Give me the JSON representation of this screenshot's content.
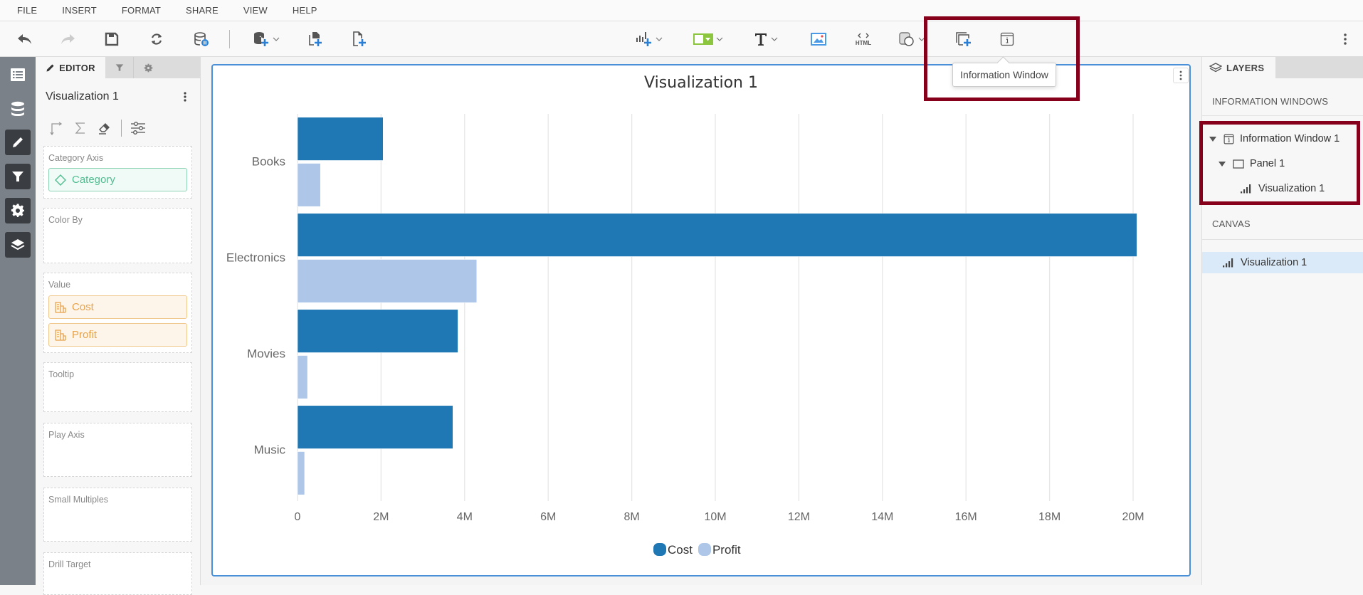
{
  "menu": [
    "FILE",
    "INSERT",
    "FORMAT",
    "SHARE",
    "VIEW",
    "HELP"
  ],
  "toolbar": {
    "tooltip": "Information Window",
    "html_label": "HTML",
    "items": [
      "undo",
      "redo",
      "save",
      "refresh",
      "pause-data",
      "add-data",
      "duplicate-page",
      "new-page",
      "insert-visualization",
      "insert-filter",
      "insert-text",
      "insert-image",
      "insert-html",
      "insert-shape",
      "insert-panel",
      "insert-information-window",
      "more"
    ]
  },
  "editor": {
    "tabs": {
      "editor": "EDITOR"
    },
    "title": "Visualization 1",
    "wells": [
      {
        "label": "Category Axis",
        "items": [
          {
            "label": "Category",
            "kind": "attribute"
          }
        ]
      },
      {
        "label": "Color By",
        "items": []
      },
      {
        "label": "Value",
        "items": [
          {
            "label": "Cost",
            "kind": "metric"
          },
          {
            "label": "Profit",
            "kind": "metric"
          }
        ]
      },
      {
        "label": "Tooltip",
        "items": []
      },
      {
        "label": "Play Axis",
        "items": []
      },
      {
        "label": "Small Multiples",
        "items": []
      },
      {
        "label": "Drill Target",
        "items": []
      }
    ]
  },
  "layers": {
    "tab": "LAYERS",
    "sections": {
      "info_windows": "INFORMATION WINDOWS",
      "canvas": "CANVAS"
    },
    "info_tree": [
      {
        "label": "Information Window 1",
        "level": 0,
        "expanded": true
      },
      {
        "label": "Panel 1",
        "level": 1,
        "expanded": true
      },
      {
        "label": "Visualization 1",
        "level": 2
      }
    ],
    "canvas_items": [
      {
        "label": "Visualization 1",
        "selected": true
      }
    ]
  },
  "colors": {
    "highlight": "#86001b",
    "cost": "#1f77b4",
    "profit": "#aec7e8",
    "accent": "#4a90d9"
  },
  "chart_data": {
    "type": "bar",
    "orientation": "horizontal",
    "title": "Visualization 1",
    "categories": [
      "Books",
      "Electronics",
      "Movies",
      "Music"
    ],
    "series": [
      {
        "name": "Cost",
        "color": "#1f77b4",
        "values": [
          2050000,
          20090000,
          3840000,
          3720000
        ]
      },
      {
        "name": "Profit",
        "color": "#aec7e8",
        "values": [
          550000,
          4290000,
          240000,
          170000
        ]
      }
    ],
    "xlabel": "",
    "ylabel": "",
    "xlim": [
      0,
      20000000
    ],
    "xticks": [
      0,
      2000000,
      4000000,
      6000000,
      8000000,
      10000000,
      12000000,
      14000000,
      16000000,
      18000000,
      20000000
    ],
    "xtick_labels": [
      "0",
      "2M",
      "4M",
      "6M",
      "8M",
      "10M",
      "12M",
      "14M",
      "16M",
      "18M",
      "20M"
    ],
    "grid": true,
    "legend": {
      "position": "bottom",
      "entries": [
        "Cost",
        "Profit"
      ]
    }
  }
}
